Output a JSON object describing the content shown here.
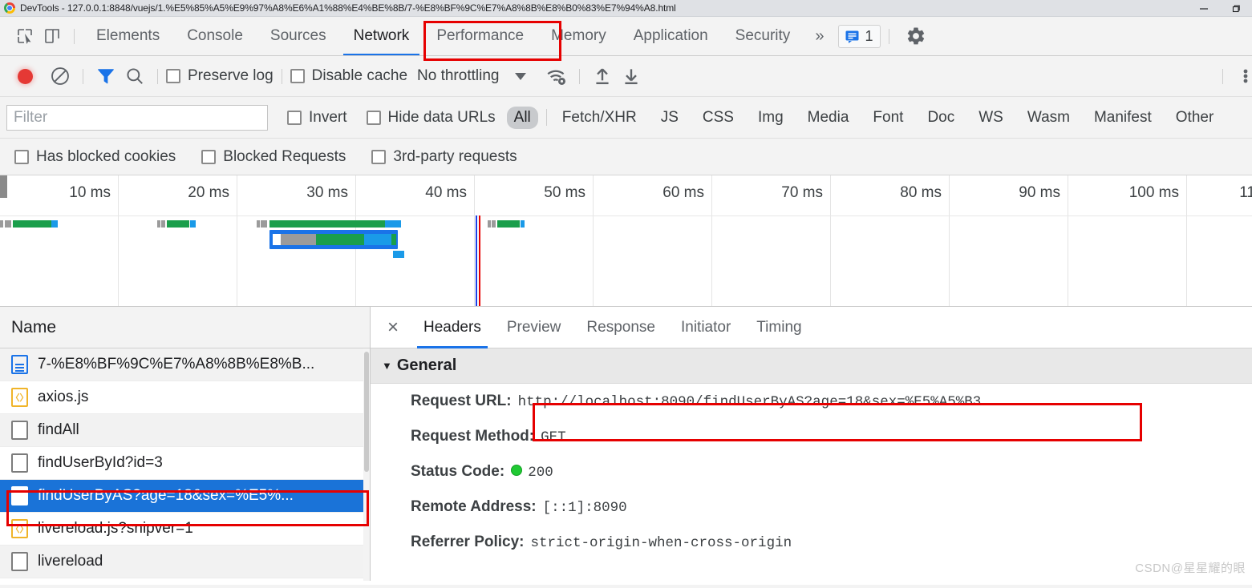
{
  "window": {
    "title": "DevTools - 127.0.0.1:8848/vuejs/1.%E5%85%A5%E9%97%A8%E6%A1%88%E4%BE%8B/7-%E8%BF%9C%E7%A8%8B%E8%B0%83%E7%94%A8.html",
    "minimize_label": "minimize",
    "maximize_label": "maximize"
  },
  "tabs": {
    "items": [
      {
        "label": "Elements",
        "selected": false
      },
      {
        "label": "Console",
        "selected": false
      },
      {
        "label": "Sources",
        "selected": false
      },
      {
        "label": "Network",
        "selected": true
      },
      {
        "label": "Performance",
        "selected": false
      },
      {
        "label": "Memory",
        "selected": false
      },
      {
        "label": "Application",
        "selected": false
      },
      {
        "label": "Security",
        "selected": false
      }
    ],
    "more_label": "»",
    "message_count": "1"
  },
  "network_toolbar": {
    "preserve_log": "Preserve log",
    "disable_cache": "Disable cache",
    "throttling": "No throttling"
  },
  "filter_bar": {
    "placeholder": "Filter",
    "value": "",
    "invert": "Invert",
    "hide_data_urls": "Hide data URLs",
    "types": [
      {
        "label": "All",
        "active": true
      },
      {
        "label": "Fetch/XHR",
        "active": false
      },
      {
        "label": "JS",
        "active": false
      },
      {
        "label": "CSS",
        "active": false
      },
      {
        "label": "Img",
        "active": false
      },
      {
        "label": "Media",
        "active": false
      },
      {
        "label": "Font",
        "active": false
      },
      {
        "label": "Doc",
        "active": false
      },
      {
        "label": "WS",
        "active": false
      },
      {
        "label": "Wasm",
        "active": false
      },
      {
        "label": "Manifest",
        "active": false
      },
      {
        "label": "Other",
        "active": false
      }
    ]
  },
  "checkbox_row": {
    "has_blocked_cookies": "Has blocked cookies",
    "blocked_requests": "Blocked Requests",
    "third_party_requests": "3rd-party requests"
  },
  "overview": {
    "ticks": [
      "10 ms",
      "20 ms",
      "30 ms",
      "40 ms",
      "50 ms",
      "60 ms",
      "70 ms",
      "80 ms",
      "90 ms",
      "100 ms",
      "11"
    ],
    "colors": {
      "waiting": "#1a9e4b",
      "download": "#1a9ae8",
      "stalled": "#9b9b9b",
      "highlight": "#1a73e8",
      "dom_content_loaded": "#1a3fe8",
      "load": "#e60000"
    }
  },
  "request_list": {
    "column_header": "Name",
    "rows": [
      {
        "name": "7-%E8%BF%9C%E7%A8%8B%E8%B...",
        "icon": "document-icon",
        "selected": false
      },
      {
        "name": "axios.js",
        "icon": "script-icon",
        "selected": false
      },
      {
        "name": "findAll",
        "icon": "xhr-icon",
        "selected": false
      },
      {
        "name": "findUserById?id=3",
        "icon": "xhr-icon",
        "selected": false
      },
      {
        "name": "findUserByAS?age=18&sex=%E5%...",
        "icon": "xhr-icon",
        "selected": true
      },
      {
        "name": "livereload.js?snipver=1",
        "icon": "script-icon",
        "selected": false
      },
      {
        "name": "livereload",
        "icon": "xhr-icon",
        "selected": false
      }
    ]
  },
  "details": {
    "close_label": "×",
    "tabs": [
      {
        "label": "Headers",
        "active": true
      },
      {
        "label": "Preview",
        "active": false
      },
      {
        "label": "Response",
        "active": false
      },
      {
        "label": "Initiator",
        "active": false
      },
      {
        "label": "Timing",
        "active": false
      }
    ],
    "general": {
      "section_title": "General",
      "caret": "▼",
      "rows": [
        {
          "key": "Request URL:",
          "value": "http://localhost:8090/findUserByAS?age=18&sex=%E5%A5%B3",
          "highlighted": true
        },
        {
          "key": "Request Method:",
          "value": "GET",
          "highlighted": false
        },
        {
          "key": "Status Code:",
          "value": "200",
          "status": "ok",
          "highlighted": false
        },
        {
          "key": "Remote Address:",
          "value": "[::1]:8090",
          "highlighted": false
        },
        {
          "key": "Referrer Policy:",
          "value": "strict-origin-when-cross-origin",
          "highlighted": false
        }
      ]
    }
  },
  "watermark": {
    "text": "CSDN@星星耀的眼"
  },
  "annotation_color": "#e60000"
}
